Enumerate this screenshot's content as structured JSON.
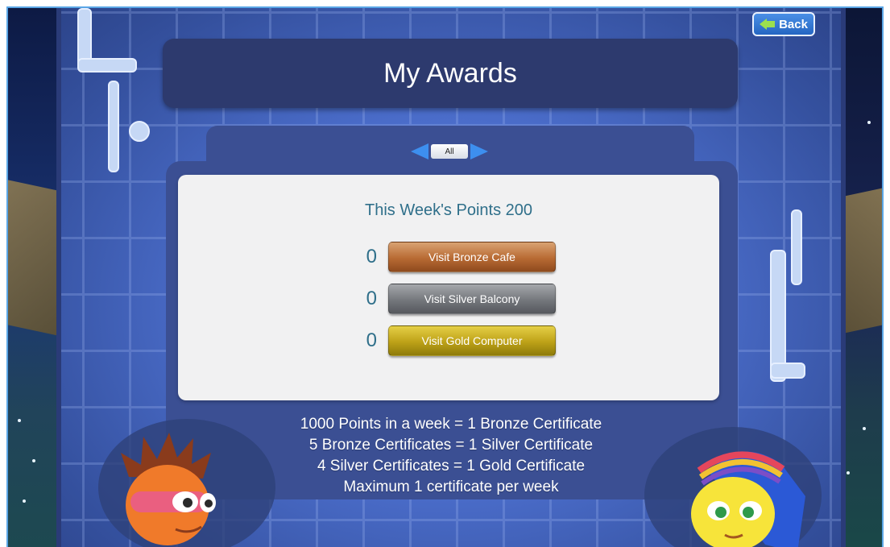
{
  "header": {
    "title": "My Awards",
    "back_label": "Back"
  },
  "filter": {
    "selected": "All"
  },
  "awards": {
    "weekly_points_text": "This Week's Points 200",
    "rows": [
      {
        "count": "0",
        "label": "Visit Bronze Cafe",
        "color": "#b86a33"
      },
      {
        "count": "0",
        "label": "Visit Silver Balcony",
        "color": "#74777c"
      },
      {
        "count": "0",
        "label": "Visit Gold Computer",
        "color": "#bda117"
      }
    ]
  },
  "rules": [
    "1000 Points in a week = 1 Bronze Certificate",
    "5 Bronze Certificates = 1 Silver Certificate",
    "4 Silver Certificates = 1 Gold Certificate",
    "Maximum 1 certificate per week"
  ],
  "colors": {
    "frame": "#5aa6e6",
    "board": "#4a6cc9",
    "banner": "#2d3a6e",
    "points_text": "#2f6f8a"
  }
}
